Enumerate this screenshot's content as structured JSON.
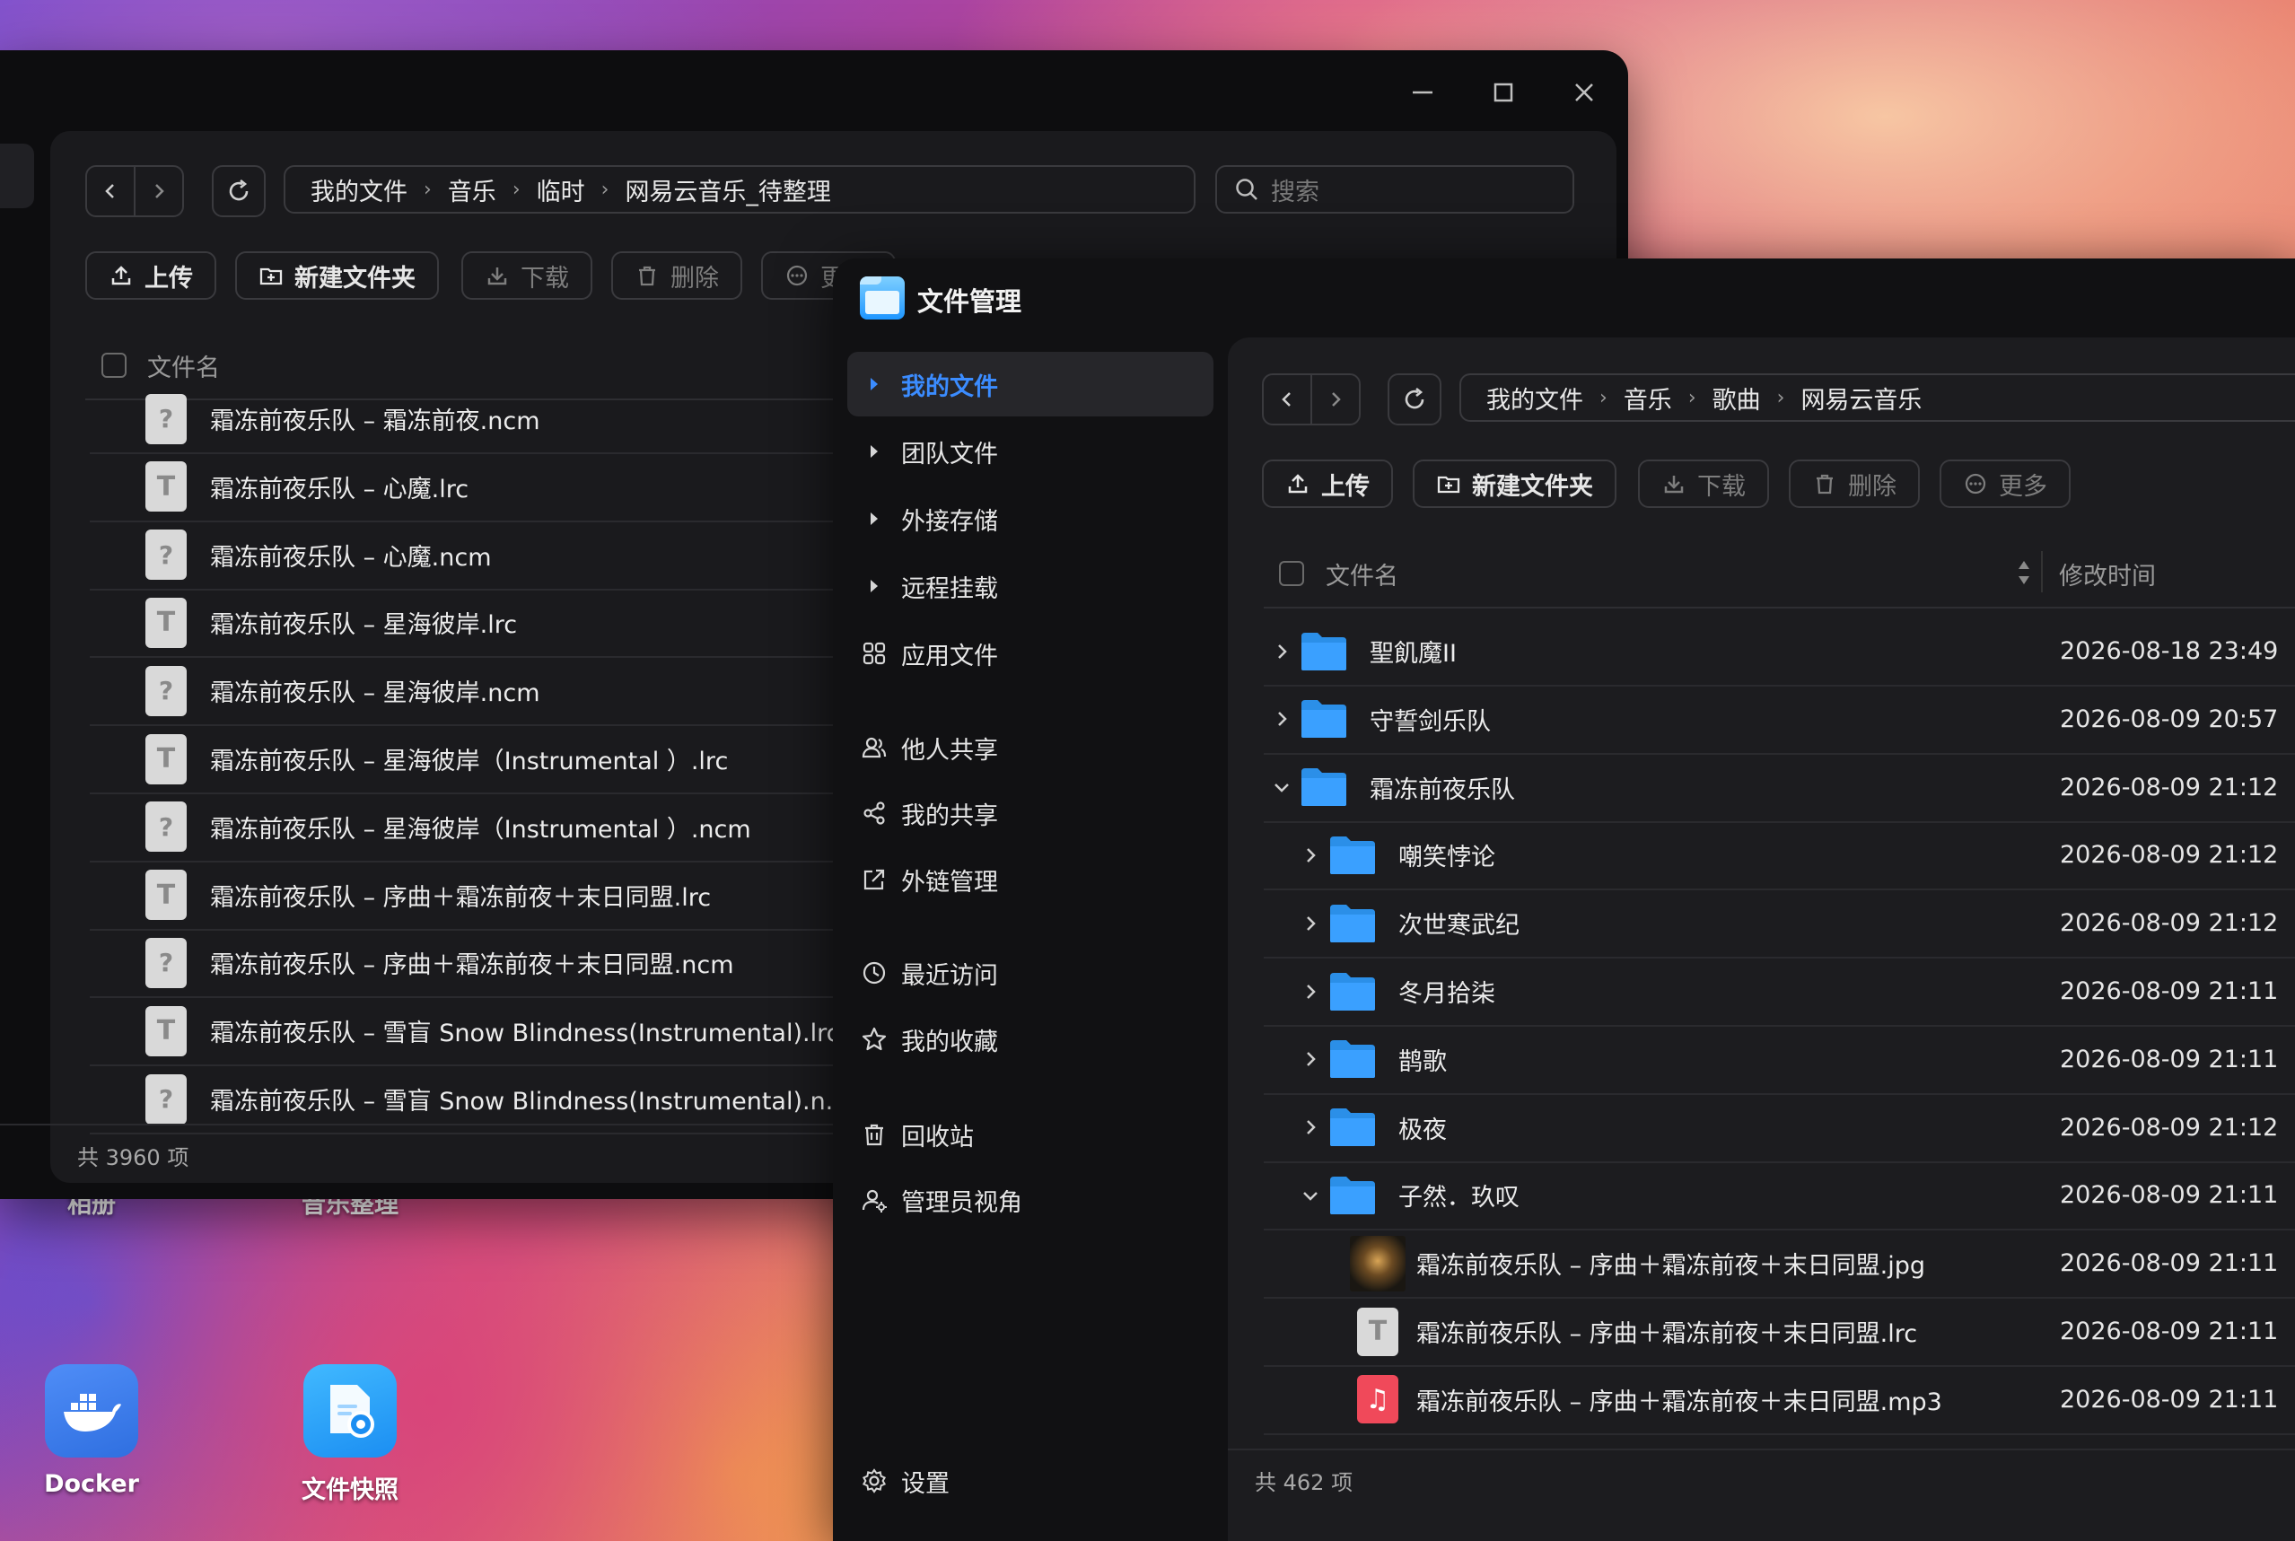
{
  "desktop": {
    "icons": [
      {
        "label": "相册"
      },
      {
        "label": "音乐整理"
      },
      {
        "label": "Docker"
      },
      {
        "label": "文件快照"
      }
    ]
  },
  "back_window": {
    "breadcrumb": [
      "我的文件",
      "音乐",
      "临时",
      "网易云音乐_待整理"
    ],
    "search_placeholder": "搜索",
    "toolbar": {
      "upload": "上传",
      "new_folder": "新建文件夹",
      "download": "下载",
      "delete": "删除",
      "more": "更多"
    },
    "column_filename": "文件名",
    "files": [
      {
        "name": "霜冻前夜乐队 – 霜冻前夜.ncm",
        "type": "unknown"
      },
      {
        "name": "霜冻前夜乐队 – 心魔.lrc",
        "type": "text"
      },
      {
        "name": "霜冻前夜乐队 – 心魔.ncm",
        "type": "unknown"
      },
      {
        "name": "霜冻前夜乐队 – 星海彼岸.lrc",
        "type": "text"
      },
      {
        "name": "霜冻前夜乐队 – 星海彼岸.ncm",
        "type": "unknown"
      },
      {
        "name": "霜冻前夜乐队 – 星海彼岸（Instrumental ）.lrc",
        "type": "text"
      },
      {
        "name": "霜冻前夜乐队 – 星海彼岸（Instrumental ）.ncm",
        "type": "unknown"
      },
      {
        "name": "霜冻前夜乐队 – 序曲＋霜冻前夜＋末日同盟.lrc",
        "type": "text"
      },
      {
        "name": "霜冻前夜乐队 – 序曲＋霜冻前夜＋末日同盟.ncm",
        "type": "unknown"
      },
      {
        "name": "霜冻前夜乐队 – 雪盲 Snow Blindness(Instrumental).lrc",
        "type": "text"
      },
      {
        "name": "霜冻前夜乐队 – 雪盲 Snow Blindness(Instrumental).n...",
        "type": "unknown"
      }
    ],
    "footer": "共 3960 项"
  },
  "front_window": {
    "app_title": "文件管理",
    "sidebar": [
      {
        "label": "我的文件",
        "icon": "caret-right-icon",
        "active": true
      },
      {
        "label": "团队文件",
        "icon": "caret-right-icon"
      },
      {
        "label": "外接存储",
        "icon": "caret-right-icon"
      },
      {
        "label": "远程挂载",
        "icon": "caret-right-icon"
      },
      {
        "label": "应用文件",
        "icon": "apps-icon"
      },
      {
        "label": "他人共享",
        "icon": "people-icon"
      },
      {
        "label": "我的共享",
        "icon": "share-icon"
      },
      {
        "label": "外链管理",
        "icon": "external-link-icon"
      },
      {
        "label": "最近访问",
        "icon": "clock-icon"
      },
      {
        "label": "我的收藏",
        "icon": "star-icon"
      },
      {
        "label": "回收站",
        "icon": "trash-icon"
      },
      {
        "label": "管理员视角",
        "icon": "admin-icon"
      }
    ],
    "settings_label": "设置",
    "breadcrumb": [
      "我的文件",
      "音乐",
      "歌曲",
      "网易云音乐"
    ],
    "toolbar": {
      "upload": "上传",
      "new_folder": "新建文件夹",
      "download": "下载",
      "delete": "删除",
      "more": "更多"
    },
    "columns": {
      "name": "文件名",
      "modified": "修改时间"
    },
    "rows": [
      {
        "name": "聖飢魔II",
        "date": "2026-08-18 23:49",
        "kind": "folder",
        "level": 0,
        "expanded": false
      },
      {
        "name": "守誓剑乐队",
        "date": "2026-08-09 20:57",
        "kind": "folder",
        "level": 0,
        "expanded": false
      },
      {
        "name": "霜冻前夜乐队",
        "date": "2026-08-09 21:12",
        "kind": "folder",
        "level": 0,
        "expanded": true
      },
      {
        "name": "嘲笑悖论",
        "date": "2026-08-09 21:12",
        "kind": "folder",
        "level": 1,
        "expanded": false
      },
      {
        "name": "次世寒武纪",
        "date": "2026-08-09 21:12",
        "kind": "folder",
        "level": 1,
        "expanded": false
      },
      {
        "name": "冬月拾柒",
        "date": "2026-08-09 21:11",
        "kind": "folder",
        "level": 1,
        "expanded": false
      },
      {
        "name": "鹊歌",
        "date": "2026-08-09 21:11",
        "kind": "folder",
        "level": 1,
        "expanded": false
      },
      {
        "name": "极夜",
        "date": "2026-08-09 21:12",
        "kind": "folder",
        "level": 1,
        "expanded": false
      },
      {
        "name": "子然．玖叹",
        "date": "2026-08-09 21:11",
        "kind": "folder",
        "level": 1,
        "expanded": true
      },
      {
        "name": "霜冻前夜乐队 – 序曲＋霜冻前夜＋末日同盟.jpg",
        "date": "2026-08-09 21:11",
        "kind": "image",
        "level": 2
      },
      {
        "name": "霜冻前夜乐队 – 序曲＋霜冻前夜＋末日同盟.lrc",
        "date": "2026-08-09 21:11",
        "kind": "text",
        "level": 2
      },
      {
        "name": "霜冻前夜乐队 – 序曲＋霜冻前夜＋末日同盟.mp3",
        "date": "2026-08-09 21:11",
        "kind": "audio",
        "level": 2
      }
    ],
    "footer": "共 462 项"
  },
  "colors": {
    "accent": "#3b8cff",
    "folder": "#3aa0ff",
    "audio": "#f0495a"
  }
}
